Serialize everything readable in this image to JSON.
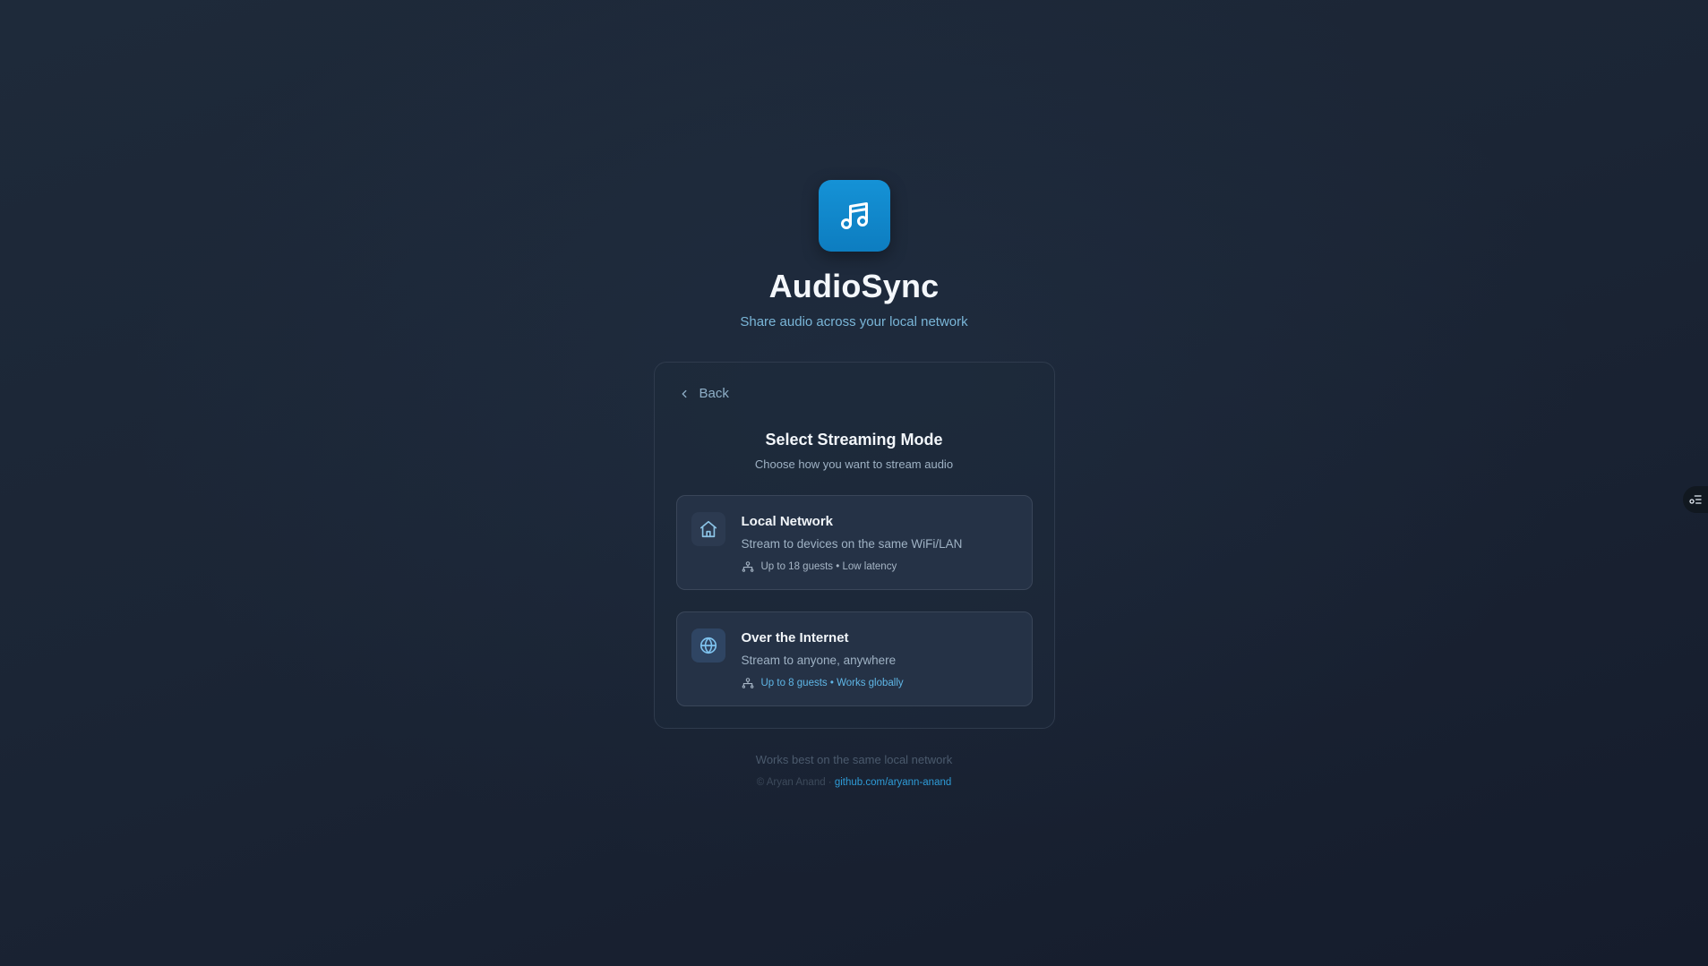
{
  "app": {
    "title": "AudioSync",
    "subtitle": "Share audio across your local network",
    "logo_icon": "music-notes-icon"
  },
  "card": {
    "back_label": "Back",
    "title": "Select Streaming Mode",
    "subtitle": "Choose how you want to stream audio",
    "options": [
      {
        "icon": "home-icon",
        "title": "Local Network",
        "description": "Stream to devices on the same WiFi/LAN",
        "meta": "Up to 18 guests • Low latency"
      },
      {
        "icon": "globe-icon",
        "title": "Over the Internet",
        "description": "Stream to anyone, anywhere",
        "meta": "Up to 8 guests • Works globally"
      }
    ]
  },
  "footer": {
    "note": "Works best on the same local network",
    "credit_prefix": "© Aryan Anand ·",
    "credit_link": "github.com/aryann-anand"
  },
  "colors": {
    "accent": "#1592d6",
    "link": "#2e9bd6",
    "background": "#1b2535"
  }
}
